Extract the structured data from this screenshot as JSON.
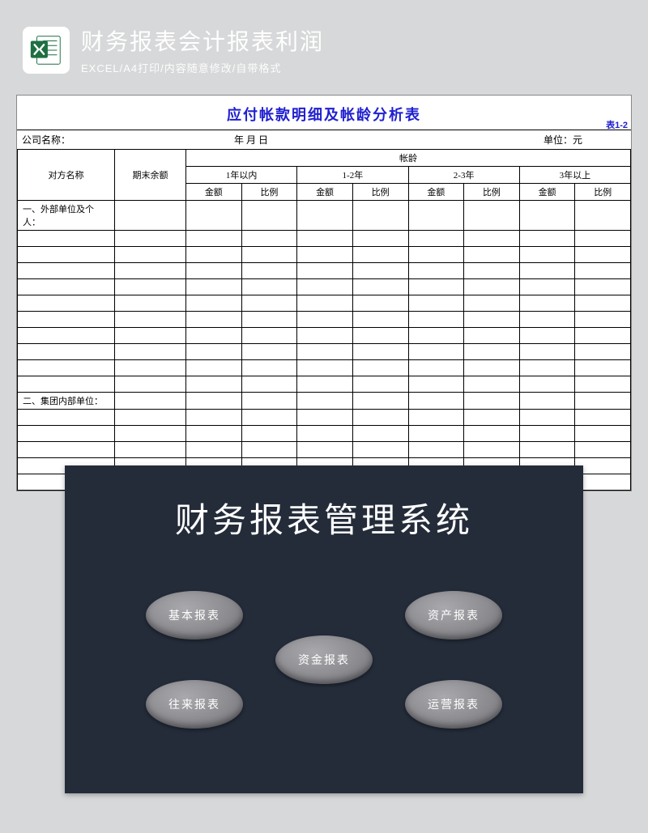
{
  "header": {
    "title": "财务报表会计报表利润",
    "subtitle": "EXCEL/A4打印/内容随意修改/自带格式",
    "icon": "excel-icon"
  },
  "sheet": {
    "title": "应付帐款明细及帐龄分析表",
    "corner": "表1-2",
    "meta": {
      "company_label": "公司名称：",
      "date_label": "年  月  日",
      "unit_label": "单位：元"
    },
    "headers": {
      "party": "对方名称",
      "balance": "期末余额",
      "aging": "帐龄",
      "buckets": [
        "1年以内",
        "1-2年",
        "2-3年",
        "3年以上"
      ],
      "amount": "金额",
      "ratio": "比例"
    },
    "rows": {
      "section1": "一、外部单位及个人：",
      "section2": "二、集团内部单位："
    }
  },
  "panel": {
    "title": "财务报表管理系统",
    "buttons": {
      "b1": "基本报表",
      "b2": "往来报表",
      "b3": "资金报表",
      "b4": "资产报表",
      "b5": "运营报表"
    }
  }
}
